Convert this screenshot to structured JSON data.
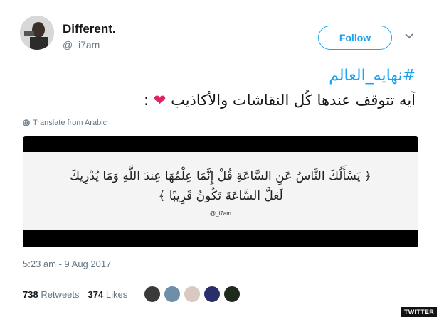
{
  "author": {
    "display_name": "Different.",
    "handle": "@_i7am"
  },
  "follow_button": {
    "label": "Follow"
  },
  "tweet": {
    "hashtag": "#نهايه_العالم",
    "text": "آيه تتوقف عندها كُل النقاشات والأكاذيب",
    "text_suffix": " :",
    "heart": "❤",
    "translate_label": "Translate from Arabic"
  },
  "media": {
    "verse_line_1": "﴿ يَسْأَلُكَ النَّاسُ عَنِ السَّاعَةِ قُلْ إِنَّمَا عِلْمُهَا عِندَ اللَّهِ وَمَا يُدْرِيكَ",
    "verse_line_2": "لَعَلَّ السَّاعَةَ تَكُونُ قَرِيبًا ﴾",
    "watermark": "@_i7am"
  },
  "timestamp": "5:23 am - 9 Aug 2017",
  "stats": {
    "retweets_count": "738",
    "retweets_label": "Retweets",
    "likes_count": "374",
    "likes_label": "Likes"
  },
  "liker_colors": [
    "#3a3a3a",
    "#6f8fa8",
    "#d9c9c0",
    "#2a2f6a",
    "#1f2a1f"
  ],
  "brand_tag": "TWITTER",
  "colors": {
    "accent": "#1da1f2",
    "heart": "#e0245e",
    "muted": "#657786"
  }
}
